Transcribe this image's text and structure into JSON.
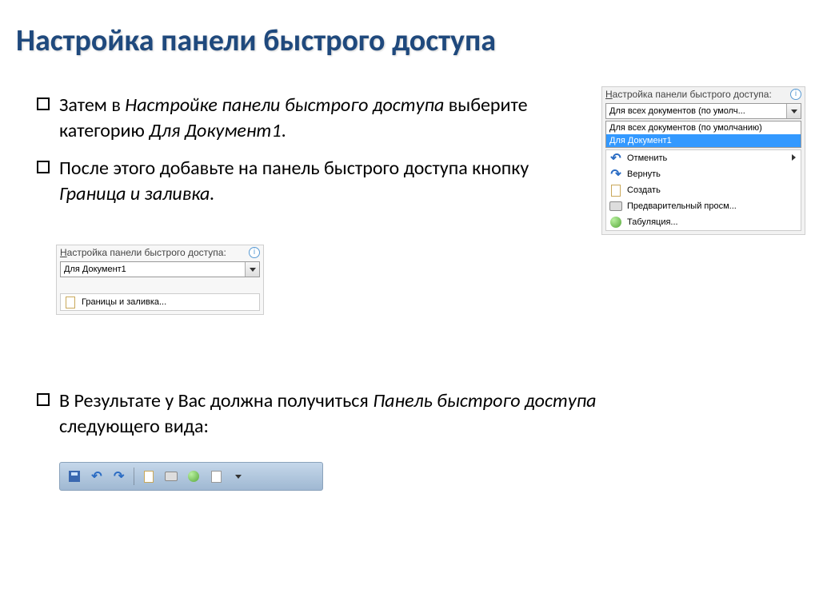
{
  "title": "Настройка панели быстрого доступа",
  "para1": {
    "a": "Затем в ",
    "b": "Настройке панели быстрого доступа",
    "c": " выберите категорию ",
    "d": "Для Документ1",
    "e": "."
  },
  "para2": {
    "a": "После этого добавьте на панель быстрого доступа кнопку ",
    "b": "Граница и заливка.",
    "c": ""
  },
  "para3": {
    "a": "В Результате у Вас должна получиться ",
    "b": "Панель быстрого доступа",
    "c": " следующего вида:"
  },
  "panel_right": {
    "label_pre": "Н",
    "label_rest": "астройка панели быстрого доступа:",
    "dd_selected": "Для всех документов (по умолч...",
    "dd_options": [
      "Для всех документов (по умолчанию)",
      "Для Документ1"
    ],
    "commands": [
      {
        "icon": "undo",
        "label": "Отменить",
        "submenu": true
      },
      {
        "icon": "redo",
        "label": "Вернуть",
        "submenu": false
      },
      {
        "icon": "doc",
        "label": "Создать",
        "submenu": false
      },
      {
        "icon": "print",
        "label": "Предварительный просм...",
        "submenu": false
      },
      {
        "icon": "globe",
        "label": "Табуляция...",
        "submenu": false
      }
    ]
  },
  "panel_mid": {
    "label_pre": "Н",
    "label_rest": "астройка панели быстрого доступа:",
    "dd_selected": "Для Документ1",
    "cmd_label": "Границы и заливка..."
  }
}
